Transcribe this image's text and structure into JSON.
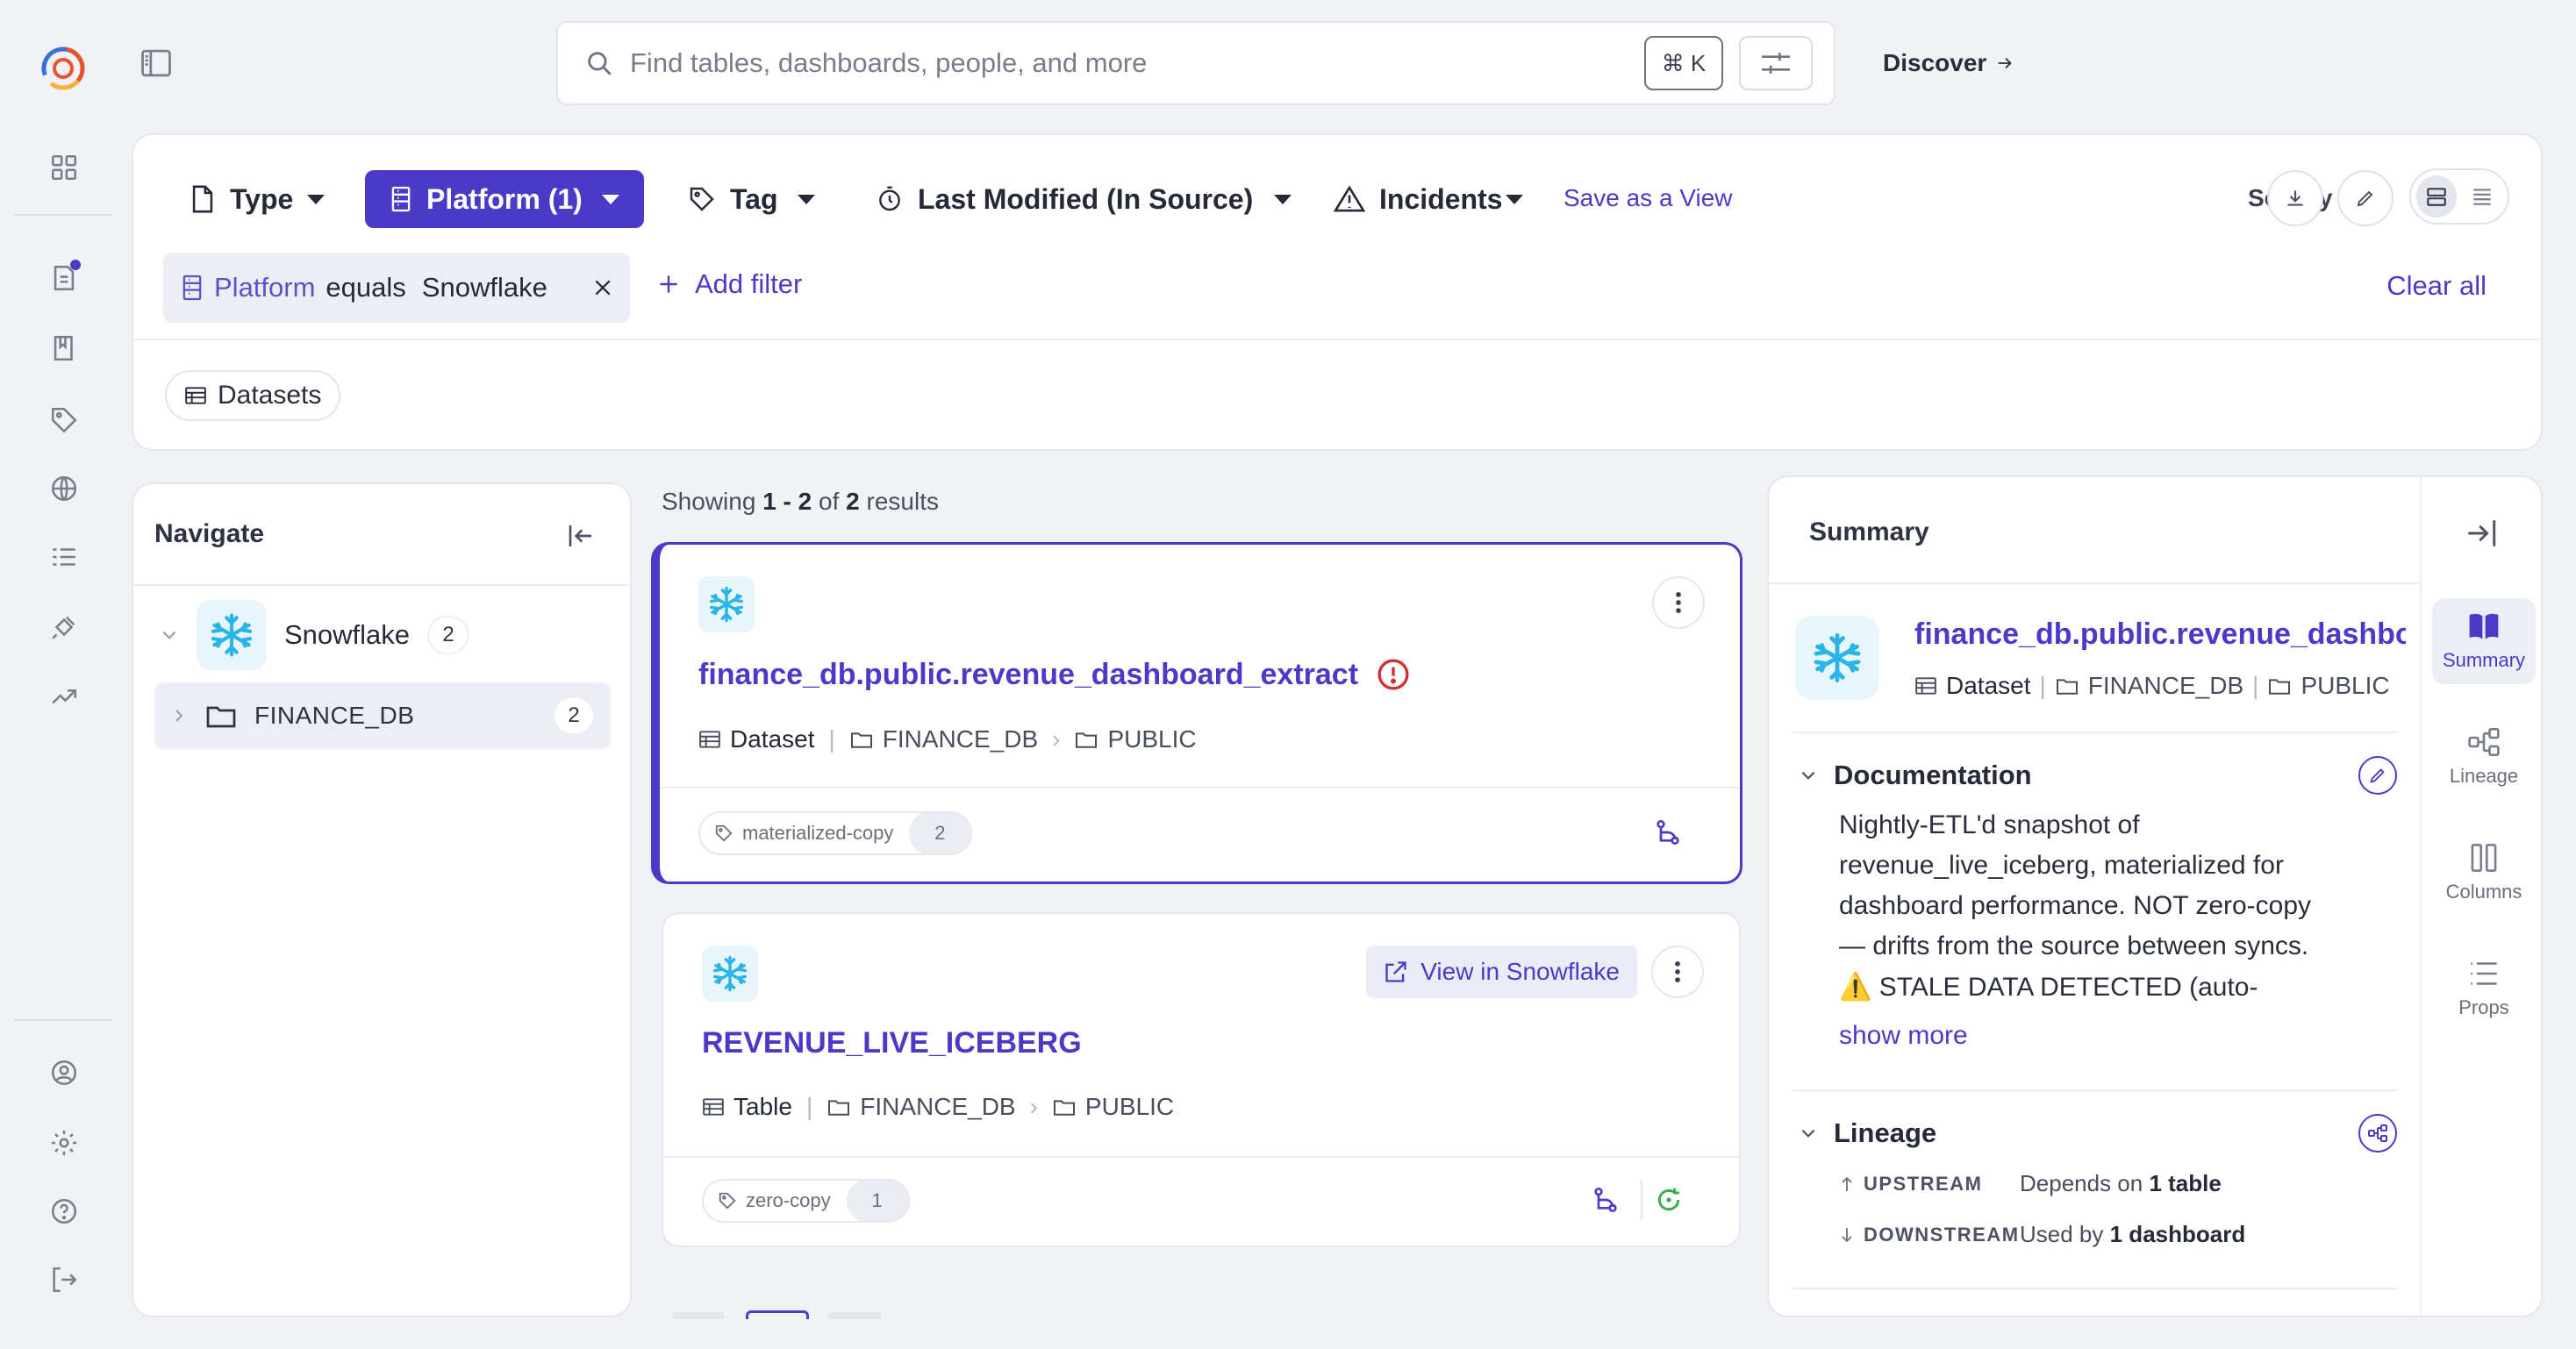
{
  "search": {
    "placeholder": "Find tables, dashboards, people, and more",
    "shortcut": "⌘ K"
  },
  "header": {
    "discover_label": "Discover"
  },
  "filters": {
    "type_label": "Type",
    "platform_label": "Platform (1)",
    "tag_label": "Tag",
    "last_modified_label": "Last Modified (In Source)",
    "incidents_label": "Incidents",
    "save_view_label": "Save as a View",
    "sort_label": "Sort by",
    "active_filter": {
      "field": "Platform",
      "operator": "equals",
      "value": "Snowflake"
    },
    "add_filter_label": "Add filter",
    "clear_all_label": "Clear all",
    "entity_chip": "Datasets"
  },
  "navigate": {
    "title": "Navigate",
    "platform": {
      "name": "Snowflake",
      "count": "2"
    },
    "database": {
      "name": "FINANCE_DB",
      "count": "2"
    }
  },
  "results": {
    "showing_prefix": "Showing",
    "range": "1 - 2",
    "of_label": "of",
    "total": "2",
    "suffix": "results",
    "items": [
      {
        "title": "finance_db.public.revenue_dashboard_extract",
        "type": "Dataset",
        "database": "FINANCE_DB",
        "schema": "PUBLIC",
        "tag": "materialized-copy",
        "tag_count": "2"
      },
      {
        "title": "REVENUE_LIVE_ICEBERG",
        "type": "Table",
        "database": "FINANCE_DB",
        "schema": "PUBLIC",
        "tag": "zero-copy",
        "tag_count": "1",
        "view_in_label": "View in Snowflake"
      }
    ]
  },
  "summary": {
    "title": "Summary",
    "entity_title": "finance_db.public.revenue_dashboard_extract",
    "type": "Dataset",
    "database": "FINANCE_DB",
    "schema": "PUBLIC",
    "documentation": {
      "heading": "Documentation",
      "lines": [
        "Nightly-ETL'd snapshot of",
        "revenue_live_iceberg, materialized for",
        "dashboard performance. NOT zero-copy",
        "— drifts from the source between syncs.",
        "⚠️ STALE DATA DETECTED (auto-"
      ],
      "show_more": "show more"
    },
    "lineage": {
      "heading": "Lineage",
      "upstream_label": "UPSTREAM",
      "upstream_prefix": "Depends on",
      "upstream_value": "1 table",
      "downstream_label": "DOWNSTREAM",
      "downstream_prefix": "Used by",
      "downstream_value": "1 dashboard"
    },
    "tabs": [
      "Summary",
      "Lineage",
      "Columns",
      "Props"
    ]
  },
  "colors": {
    "accent": "#4b3ac8",
    "snowflake": "#29b5e8",
    "error": "#d32f2f",
    "success": "#3cae49"
  }
}
